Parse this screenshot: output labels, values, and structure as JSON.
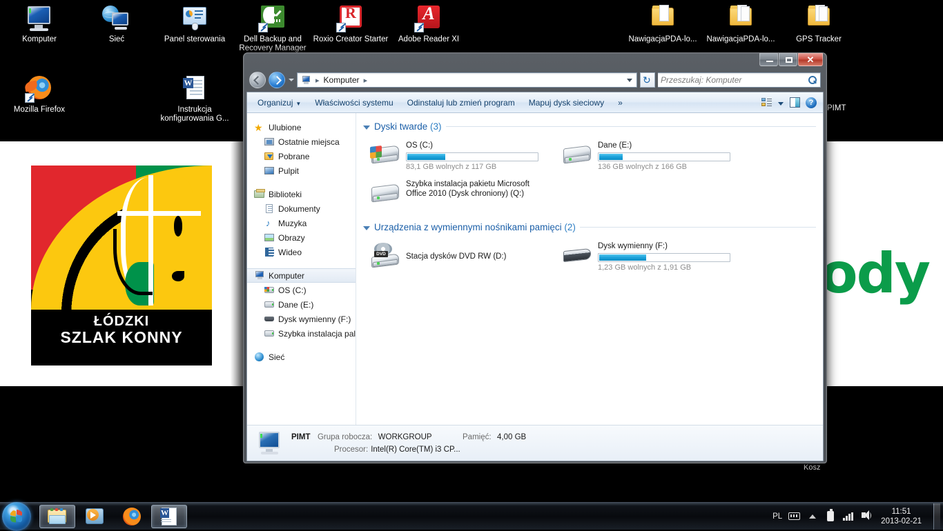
{
  "desktop": {
    "icons_row1": [
      {
        "label": "Komputer",
        "icon": "computer-icon"
      },
      {
        "label": "Sieć",
        "icon": "network-icon"
      },
      {
        "label": "Panel sterowania",
        "icon": "control-panel-icon"
      },
      {
        "label": "Dell Backup and Recovery Manager",
        "icon": "dell-backup-icon"
      },
      {
        "label": "Roxio Creator Starter",
        "icon": "roxio-icon"
      },
      {
        "label": "Adobe Reader XI",
        "icon": "adobe-reader-icon"
      }
    ],
    "icons_row1_right": [
      {
        "label": "NawigacjaPDA-lo...",
        "icon": "folder-icon"
      },
      {
        "label": "NawigacjaPDA-lo...",
        "icon": "folder-icon"
      },
      {
        "label": "GPS Tracker",
        "icon": "folder-icon"
      }
    ],
    "icons_row2": [
      {
        "label": "Mozilla Firefox",
        "icon": "firefox-icon"
      },
      {
        "label": "Instrukcja konfigurowania G...",
        "icon": "word-document-icon"
      }
    ],
    "recycle_bin_label": "Kosz",
    "partial_label": "PIMT",
    "wallpaper": {
      "logo_line1": "ŁÓDZKI",
      "logo_line2": "SZLAK KONNY",
      "green_text": "ody",
      "green_hex": "#0b9c4a",
      "red_hex": "#e1272d",
      "yellow_hex": "#fcc80f"
    }
  },
  "window": {
    "title_buttons": {
      "minimize": "minimize-button",
      "maximize": "maximize-button",
      "close": "close-button"
    },
    "nav": {
      "back": "back-button",
      "forward": "forward-button",
      "history": "recent-pages-button",
      "refresh_glyph": "↻"
    },
    "address": {
      "root_icon": "computer-icon",
      "crumbs": [
        "Komputer"
      ],
      "sep": "▸"
    },
    "search": {
      "placeholder": "Przeszukaj: Komputer",
      "icon": "search-icon"
    },
    "toolbar": {
      "organize": "Organizuj",
      "system_properties": "Właściwości systemu",
      "uninstall": "Odinstaluj lub zmień program",
      "map_drive": "Mapuj dysk sieciowy",
      "overflow": "»",
      "view_button": "change-view-button",
      "preview_pane": "preview-pane-button",
      "help": "help-button",
      "help_glyph": "?"
    }
  },
  "navpane": {
    "groups": [
      {
        "header": {
          "label": "Ulubione",
          "icon": "star-icon"
        },
        "items": [
          {
            "label": "Ostatnie miejsca",
            "icon": "recent-places-icon"
          },
          {
            "label": "Pobrane",
            "icon": "downloads-icon"
          },
          {
            "label": "Pulpit",
            "icon": "desktop-icon"
          }
        ]
      },
      {
        "header": {
          "label": "Biblioteki",
          "icon": "libraries-icon"
        },
        "items": [
          {
            "label": "Dokumenty",
            "icon": "documents-icon"
          },
          {
            "label": "Muzyka",
            "icon": "music-icon"
          },
          {
            "label": "Obrazy",
            "icon": "pictures-icon"
          },
          {
            "label": "Wideo",
            "icon": "video-icon"
          }
        ]
      },
      {
        "header": {
          "label": "Komputer",
          "icon": "computer-icon",
          "selected": true
        },
        "items": [
          {
            "label": "OS (C:)",
            "icon": "hdd-os-icon"
          },
          {
            "label": "Dane (E:)",
            "icon": "hdd-icon"
          },
          {
            "label": "Dysk wymienny (F:)",
            "icon": "removable-disk-icon"
          },
          {
            "label": "Szybka instalacja pal",
            "icon": "hdd-icon"
          }
        ]
      },
      {
        "header": {
          "label": "Sieć",
          "icon": "network-icon"
        },
        "items": []
      }
    ]
  },
  "content": {
    "groups": [
      {
        "title": "Dyski twarde",
        "count": "(3)",
        "rows": [
          [
            {
              "name": "OS (C:)",
              "icon": "windows-hdd-icon",
              "free_text": "83,1 GB wolnych z 117 GB",
              "used_percent": 29,
              "has_gauge": true
            },
            {
              "name": "Dane (E:)",
              "icon": "hdd-icon",
              "free_text": "136 GB wolnych z 166 GB",
              "used_percent": 18,
              "has_gauge": true
            }
          ],
          [
            {
              "name": "Szybka instalacja pakietu Microsoft Office 2010 (Dysk chroniony) (Q:)",
              "icon": "hdd-icon",
              "free_text": "",
              "used_percent": 0,
              "has_gauge": false
            }
          ]
        ]
      },
      {
        "title": "Urządzenia z wymiennymi nośnikami pamięci",
        "count": "(2)",
        "rows": [
          [
            {
              "name": "Stacja dysków DVD RW (D:)",
              "icon": "dvd-drive-icon",
              "free_text": "",
              "used_percent": 0,
              "has_gauge": false
            },
            {
              "name": "Dysk wymienny (F:)",
              "icon": "removable-disk-icon",
              "free_text": "1,23 GB wolnych z 1,91 GB",
              "used_percent": 36,
              "has_gauge": true
            }
          ]
        ]
      }
    ]
  },
  "statusbar": {
    "icon": "computer-icon",
    "computer_name": "PIMT",
    "workgroup_label": "Grupa robocza:",
    "workgroup_value": "WORKGROUP",
    "memory_label": "Pamięć:",
    "memory_value": "4,00 GB",
    "processor_label": "Procesor:",
    "processor_value": "Intel(R) Core(TM) i3 CP..."
  },
  "taskbar": {
    "start_button": "start-button",
    "tasks": [
      {
        "name": "windows-explorer-task",
        "icon": "explorer-folder-icon",
        "active": true
      },
      {
        "name": "media-player-task",
        "icon": "media-player-icon",
        "active": false
      },
      {
        "name": "firefox-task",
        "icon": "firefox-icon",
        "active": false
      },
      {
        "name": "word-task",
        "icon": "word-icon",
        "active": true
      }
    ],
    "tray": {
      "language": "PL",
      "keyboard_icon": "keyboard-icon",
      "show_hidden_icon": "show-hidden-icons-chevron",
      "battery_icon": "battery-icon",
      "network_icon": "network-signal-icon",
      "volume_icon": "volume-icon",
      "time": "11:51",
      "date": "2013-02-21",
      "show_desktop": "show-desktop-button"
    }
  }
}
